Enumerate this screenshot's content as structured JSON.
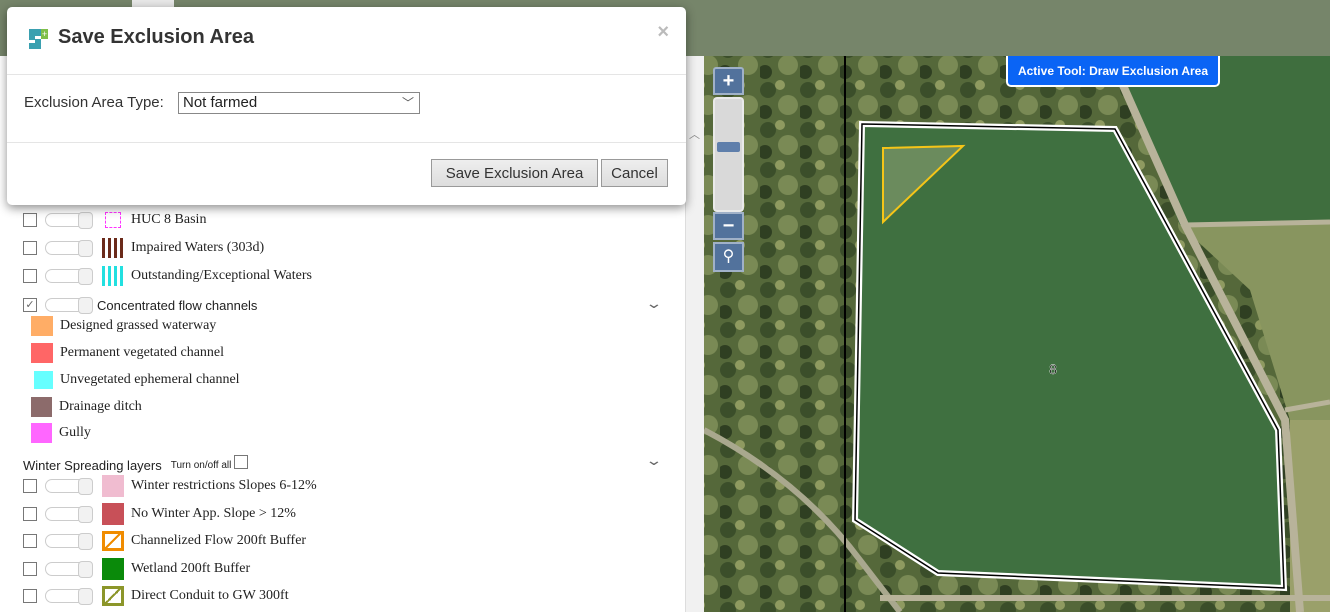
{
  "dialog": {
    "title": "Save Exclusion Area",
    "close": "×",
    "type_label": "Exclusion Area Type:",
    "type_value": "Not farmed",
    "save_label": "Save Exclusion Area",
    "cancel_label": "Cancel"
  },
  "layers": [
    {
      "label": "HUC 8 Basin",
      "checked": false
    },
    {
      "label": "Impaired Waters (303d)",
      "checked": false
    },
    {
      "label": "Outstanding/Exceptional Waters",
      "checked": false
    },
    {
      "label": "Concentrated flow channels",
      "checked": true
    }
  ],
  "flow_legend": [
    {
      "label": "Designed grassed waterway",
      "color": "#ffad66"
    },
    {
      "label": "Permanent vegetated channel",
      "color": "#ff6666"
    },
    {
      "label": "Unvegetated ephemeral channel",
      "color": "#66ffff"
    },
    {
      "label": "Drainage ditch",
      "color": "#8c6b6b"
    },
    {
      "label": "Gully",
      "color": "#ff66ff"
    }
  ],
  "winter": {
    "title": "Winter Spreading layers",
    "toggle_all": "Turn on/off all",
    "items": [
      {
        "label": "Winter restrictions Slopes 6-12%",
        "color": "#f0bcd0"
      },
      {
        "label": "No Winter App. Slope > 12%",
        "color": "#c85058"
      },
      {
        "label": "Channelized Flow 200ft Buffer",
        "color": "#f08c00"
      },
      {
        "label": " Wetland 200ft Buffer",
        "color": "#0a8a0a"
      },
      {
        "label": "Direct Conduit to GW 300ft",
        "color": "#8c962a"
      }
    ]
  },
  "map": {
    "active_tool": "Active Tool: Draw Exclusion Area",
    "field_label": "8",
    "zoom_in": "+",
    "zoom_out": "−"
  }
}
